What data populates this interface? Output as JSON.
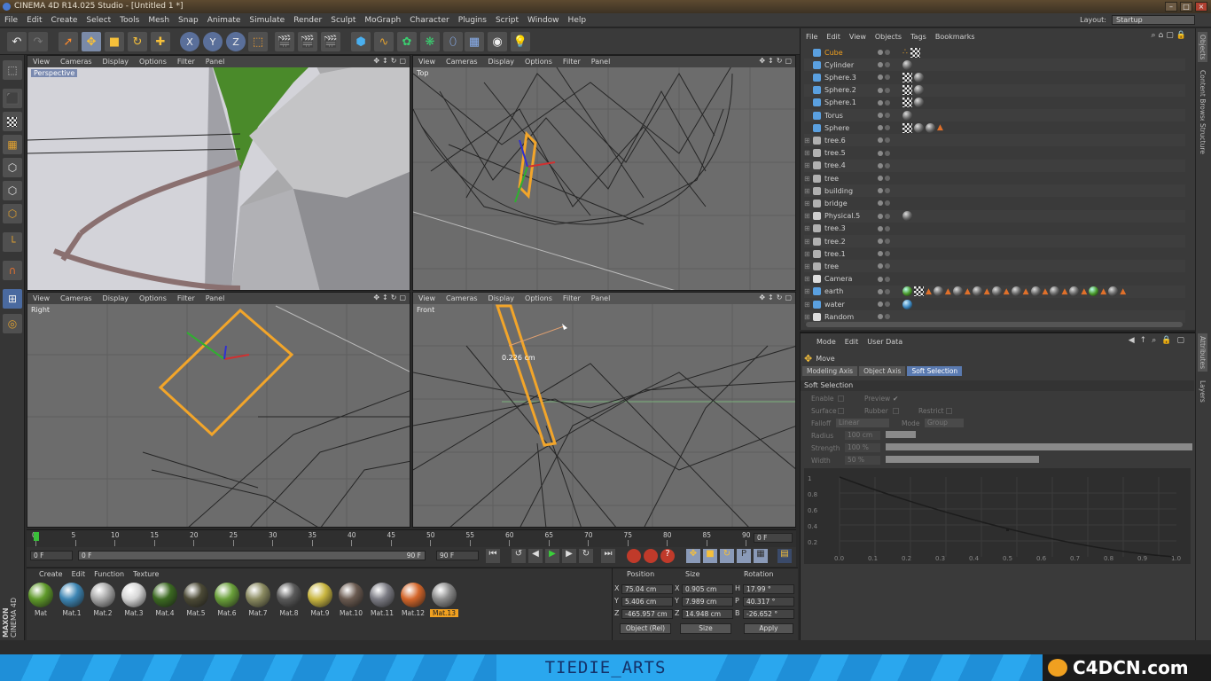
{
  "window": {
    "title": "CINEMA 4D R14.025 Studio - [Untitled 1 *]"
  },
  "menu": [
    "File",
    "Edit",
    "Create",
    "Select",
    "Tools",
    "Mesh",
    "Snap",
    "Animate",
    "Simulate",
    "Render",
    "Sculpt",
    "MoGraph",
    "Character",
    "Plugins",
    "Script",
    "Window",
    "Help"
  ],
  "layout": {
    "label": "Layout:",
    "value": "Startup"
  },
  "viewport_menu": [
    "View",
    "Cameras",
    "Display",
    "Options",
    "Filter",
    "Panel"
  ],
  "viewports": {
    "perspective": "Perspective",
    "top": "Top",
    "right": "Right",
    "front": "Front"
  },
  "measure": "0.226 cm",
  "timeline": {
    "ticks": [
      "0",
      "5",
      "10",
      "15",
      "20",
      "25",
      "30",
      "35",
      "40",
      "45",
      "50",
      "55",
      "60",
      "65",
      "70",
      "75",
      "80",
      "85",
      "90"
    ],
    "current": "0 F",
    "start": "0 F",
    "end": "90 F",
    "range_start": "0 F",
    "range_end": "90 F"
  },
  "material_menu": [
    "Create",
    "Edit",
    "Function",
    "Texture"
  ],
  "materials": [
    {
      "name": "Mat",
      "color": "#5f9a2a"
    },
    {
      "name": "Mat.1",
      "color": "#3d86b4"
    },
    {
      "name": "Mat.2",
      "color": "#a8a8a8"
    },
    {
      "name": "Mat.3",
      "color": "#d6d6d6"
    },
    {
      "name": "Mat.4",
      "color": "#3c6a22"
    },
    {
      "name": "Mat.5",
      "color": "#4c4a36"
    },
    {
      "name": "Mat.6",
      "color": "#6aa03a"
    },
    {
      "name": "Mat.7",
      "color": "#8a8a60"
    },
    {
      "name": "Mat.8",
      "color": "#5a5a5a"
    },
    {
      "name": "Mat.9",
      "color": "#c9b640"
    },
    {
      "name": "Mat.10",
      "color": "#6a5a50"
    },
    {
      "name": "Mat.11",
      "color": "#7c7c84"
    },
    {
      "name": "Mat.12",
      "color": "#d4662a"
    },
    {
      "name": "Mat.13",
      "color": "#8c8c8c"
    }
  ],
  "coords": {
    "headers": [
      "Position",
      "Size",
      "Rotation"
    ],
    "rows": [
      {
        "axis": "X",
        "pos": "75.04 cm",
        "saxis": "X",
        "size": "0.905 cm",
        "raxis": "H",
        "rot": "17.99 °"
      },
      {
        "axis": "Y",
        "pos": "5.406 cm",
        "saxis": "Y",
        "size": "7.989 cm",
        "raxis": "P",
        "rot": "40.317 °"
      },
      {
        "axis": "Z",
        "pos": "-465.957 cm",
        "saxis": "Z",
        "size": "14.948 cm",
        "raxis": "B",
        "rot": "-26.652 °"
      }
    ],
    "mode": "Object (Rel)",
    "size_mode": "Size",
    "apply": "Apply"
  },
  "object_manager": {
    "menu": [
      "File",
      "Edit",
      "View",
      "Objects",
      "Tags",
      "Bookmarks"
    ],
    "objects": [
      {
        "name": "Cube",
        "icon": "#5aa0e0"
      },
      {
        "name": "Cylinder",
        "icon": "#5aa0e0"
      },
      {
        "name": "Sphere.3",
        "icon": "#5aa0e0"
      },
      {
        "name": "Sphere.2",
        "icon": "#5aa0e0"
      },
      {
        "name": "Sphere.1",
        "icon": "#5aa0e0"
      },
      {
        "name": "Torus",
        "icon": "#5aa0e0"
      },
      {
        "name": "Sphere",
        "icon": "#5aa0e0"
      },
      {
        "name": "tree.6",
        "icon": "#b0b0b0"
      },
      {
        "name": "tree.5",
        "icon": "#b0b0b0"
      },
      {
        "name": "tree.4",
        "icon": "#b0b0b0"
      },
      {
        "name": "tree",
        "icon": "#b0b0b0"
      },
      {
        "name": "building",
        "icon": "#b0b0b0"
      },
      {
        "name": "bridge",
        "icon": "#b0b0b0"
      },
      {
        "name": "Physical.5",
        "icon": "#cfcfcf"
      },
      {
        "name": "tree.3",
        "icon": "#b0b0b0"
      },
      {
        "name": "tree.2",
        "icon": "#b0b0b0"
      },
      {
        "name": "tree.1",
        "icon": "#b0b0b0"
      },
      {
        "name": "tree",
        "icon": "#b0b0b0"
      },
      {
        "name": "Camera",
        "icon": "#dddddd"
      },
      {
        "name": "earth",
        "icon": "#5aa0e0"
      },
      {
        "name": "water",
        "icon": "#5aa0e0"
      },
      {
        "name": "Random",
        "icon": "#dddddd"
      }
    ]
  },
  "attribute_manager": {
    "menu": [
      "Mode",
      "Edit",
      "User Data"
    ],
    "tool": "Move",
    "tabs": [
      "Modeling Axis",
      "Object Axis",
      "Soft Selection"
    ],
    "section": "Soft Selection",
    "labels": {
      "enable": "Enable",
      "preview": "Preview",
      "surface": "Surface",
      "rubber": "Rubber",
      "restrict": "Restrict",
      "falloff": "Falloff",
      "falloff_val": "Linear",
      "mode": "Mode",
      "mode_val": "Group",
      "radius": "Radius",
      "radius_val": "100 cm",
      "strength": "Strength",
      "strength_val": "100 %",
      "width": "Width",
      "width_val": "50 %"
    },
    "graph_x": [
      "0.0",
      "0.1",
      "0.2",
      "0.3",
      "0.4",
      "0.5",
      "0.6",
      "0.7",
      "0.8",
      "0.9",
      "1.0"
    ],
    "graph_y": [
      "1",
      "0.8",
      "0.6",
      "0.4",
      "0.2"
    ]
  },
  "right_tabs": [
    "Objects",
    "Content Browser",
    "Structure",
    "Attributes",
    "Layers"
  ],
  "brand": {
    "maxon": "MAXON",
    "c4d": "CINEMA 4D",
    "footer": "TIEDIE_ARTS",
    "logo": "C4DCN.com"
  }
}
